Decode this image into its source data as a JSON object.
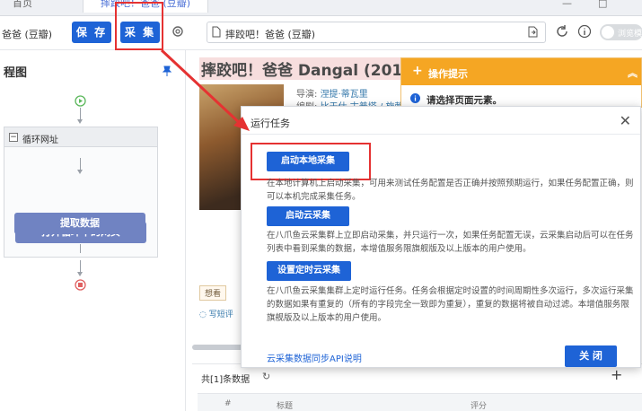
{
  "tabs": {
    "home": "首页",
    "active": "摔跤吧！爸爸 (豆瓣)",
    "window_minimize": "—",
    "window_restore": "□"
  },
  "toolbar": {
    "task_name": "爸爸 (豆瓣)",
    "save_label": "保 存",
    "collect_label": "采 集",
    "url_text": "摔跤吧！爸爸 (豆瓣)",
    "browse_mode_label": "浏览模式"
  },
  "flow": {
    "title": "程图",
    "loop_label": "循环网址",
    "node_open": "打开循环中的网页",
    "node_extract": "提取数据"
  },
  "webpage": {
    "movie_title": "摔跤吧！爸爸 Dangal (201",
    "director_label": "导演:",
    "director": "涅提·蒂瓦里",
    "writer_label": "编剧:",
    "writer": "比于仕 古普塔 / 施赖",
    "want_label": "想看",
    "review_label": "写短评",
    "total_label": "共[1]条数据",
    "table_col_title": "标题",
    "table_col_score": "评分",
    "table_col_num": "#"
  },
  "tips": {
    "title": "操作提示",
    "message": "请选择页面元素。"
  },
  "modal": {
    "title": "运行任务",
    "local_button": "启动本地采集",
    "local_desc": "在本地计算机上启动采集，可用来测试任务配置是否正确并按照预期运行，如果任务配置正确，则可以本机完成采集任务。",
    "cloud_button": "启动云采集",
    "cloud_desc": "在八爪鱼云采集群上立即启动采集，并只运行一次，如果任务配置无误，云采集启动后可以在任务列表中看到采集的数据，本增值服务限旗舰版及以上版本的用户使用。",
    "schedule_button": "设置定时云采集",
    "schedule_desc": "在八爪鱼云采集集群上定时运行任务。任务会根据定时设置的时间周期性多次运行，多次运行采集的数据如果有重复的（所有的字段完全一致即为重复），重复的数据将被自动过滤。本增值服务限旗舰版及以上版本的用户使用。",
    "api_link": "云采集数据同步API说明",
    "close_button": "关 闭"
  }
}
